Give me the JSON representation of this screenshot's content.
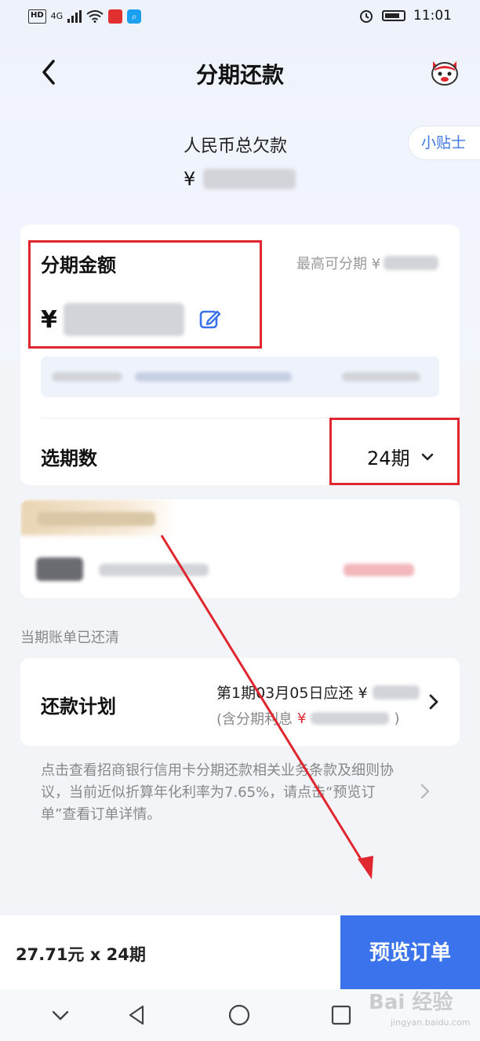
{
  "status_bar": {
    "network": "4G",
    "hd": "HD",
    "time": "11:01"
  },
  "header": {
    "title": "分期还款",
    "back_icon": "chevron-left-icon",
    "mascot_icon": "mascot-icon"
  },
  "debt": {
    "label": "人民币总欠款",
    "currency": "¥"
  },
  "tips": {
    "label": "小贴士"
  },
  "installment": {
    "amount_label": "分期金额",
    "max_label": "最高可分期 ¥",
    "currency": "¥",
    "period_label": "选期数",
    "period_value": "24期"
  },
  "status_text": "当期账单已还清",
  "plan": {
    "label": "还款计划",
    "line1": "第1期03月05日应还 ¥",
    "line2_prefix": "(含分期利息",
    "line2_yuan": "¥",
    "line2_suffix": ")"
  },
  "disclaimer": "点击查看招商银行信用卡分期还款相关业务条款及细则协议，当前近似折算年化利率为7.65%，请点击“预览订单”查看订单详情。",
  "bottom": {
    "summary": "27.71元 x 24期",
    "preview_button": "预览订单"
  },
  "watermark": {
    "text": "Bai 经验",
    "sub": "jingyan.baidu.com"
  },
  "colors": {
    "accent": "#3a73ec",
    "annotation_red": "#e0262e",
    "tips_blue": "#3f78e0"
  }
}
